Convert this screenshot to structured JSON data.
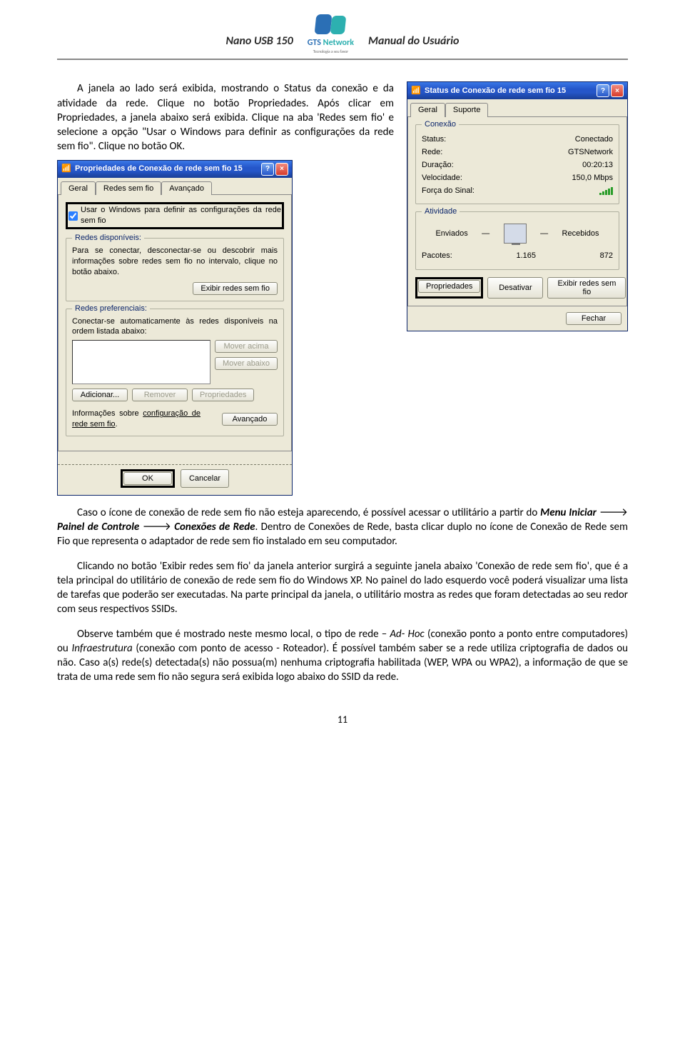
{
  "header": {
    "left": "Nano USB 150",
    "right": "Manual do Usuário",
    "logo_main": "GTS",
    "logo_sub": "Network",
    "logo_tagline": "Tecnologia a seu favor"
  },
  "intro": {
    "p1": "A janela ao lado será exibida, mostrando o Status da conexão e da atividade da rede. Clique no botão Propriedades. Após clicar em Propriedades, a janela abaixo será exibida. Clique na aba 'Redes sem fio' e selecione a opção \"Usar o Windows para definir as configurações da rede sem fio\". Clique no botão OK."
  },
  "dialog_status": {
    "title": "Status de Conexão de rede sem fio 15",
    "help": "?",
    "close": "×",
    "tabs": {
      "general": "Geral",
      "support": "Suporte"
    },
    "group_conn": "Conexão",
    "status_label": "Status:",
    "status_value": "Conectado",
    "network_label": "Rede:",
    "network_value": "GTSNetwork",
    "duration_label": "Duração:",
    "duration_value": "00:20:13",
    "speed_label": "Velocidade:",
    "speed_value": "150,0 Mbps",
    "signal_label": "Força do Sinal:",
    "group_activity": "Atividade",
    "sent_label": "Enviados",
    "recv_label": "Recebidos",
    "packets_label": "Pacotes:",
    "packets_sent": "1.165",
    "packets_recv": "872",
    "btn_props": "Propriedades",
    "btn_disable": "Desativar",
    "btn_show": "Exibir redes sem fio",
    "btn_close": "Fechar"
  },
  "dialog_props": {
    "title": "Propriedades de Conexão de rede sem fio 15",
    "help": "?",
    "close": "×",
    "tabs": {
      "general": "Geral",
      "wireless": "Redes sem fio",
      "advanced": "Avançado"
    },
    "chk_use_windows": "Usar o Windows para definir as configurações da rede sem fio",
    "group_avail": "Redes disponíveis:",
    "avail_desc": "Para se conectar, desconectar-se ou descobrir mais informações sobre redes sem fio no intervalo, clique no botão abaixo.",
    "btn_show": "Exibir redes sem fio",
    "group_pref": "Redes preferenciais:",
    "pref_desc": "Conectar-se automaticamente às redes disponíveis na ordem listada abaixo:",
    "btn_move_up": "Mover acima",
    "btn_move_down": "Mover abaixo",
    "btn_add": "Adicionar...",
    "btn_remove": "Remover",
    "btn_props": "Propriedades",
    "info_link_pre": "Informações sobre ",
    "info_link": "configuração de rede sem fio",
    "info_link_post": ".",
    "btn_adv": "Avançado",
    "btn_ok": "OK",
    "btn_cancel": "Cancelar"
  },
  "body": {
    "p2_a": "Caso o ícone de conexão de rede sem fio não esteja aparecendo, é possível acessar o utilitário a partir do ",
    "p2_menu_iniciar": "Menu Iniciar",
    "p2_arrow1": " 🡒 ",
    "p2_painel": "Painel de Controle",
    "p2_arrow2": " 🡒 ",
    "p2_conexoes": "Conexões de Rede",
    "p2_b": ". Dentro de Conexões de Rede, basta clicar duplo no ícone de Conexão de Rede sem Fio que representa o adaptador de rede sem fio instalado em seu computador.",
    "p3": "Clicando no botão 'Exibir redes sem fio' da janela anterior surgirá a seguinte janela abaixo 'Conexão de rede sem fio', que é a tela principal do utilitário de conexão de rede sem fio do Windows XP. No painel do lado esquerdo você poderá visualizar uma lista de tarefas que poderão ser executadas. Na parte principal da janela, o utilitário mostra as redes que foram detectadas ao seu redor com seus respectivos SSIDs.",
    "p4_a": "Observe também que é mostrado neste mesmo local, o tipo de rede – ",
    "p4_adhoc": "Ad- Hoc",
    "p4_b": " (conexão ponto a ponto entre computadores) ou ",
    "p4_infra": "Infraestrutura",
    "p4_c": " (conexão com ponto de acesso - Roteador). É possível também saber se a rede utiliza criptografia de dados ou não. Caso a(s) rede(s) detectada(s) não possua(m) nenhuma criptografia habilitada (WEP, WPA ou WPA2), a informação de que se trata de uma rede sem fio não segura será exibida logo abaixo do SSID da rede."
  },
  "page_number": "11"
}
